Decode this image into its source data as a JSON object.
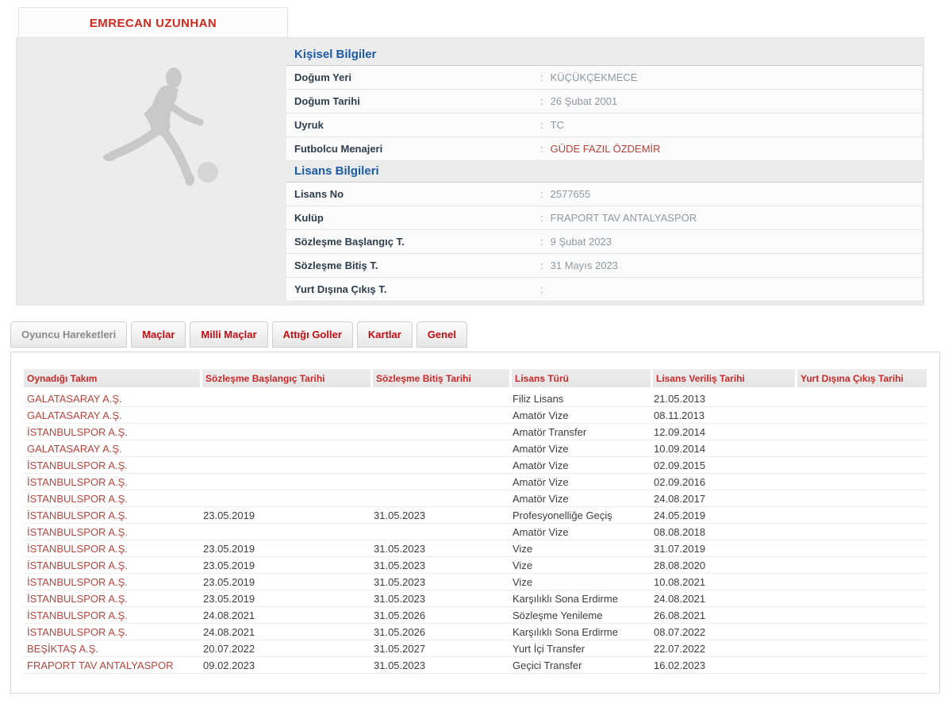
{
  "meta": {
    "colon": ":"
  },
  "player": {
    "name": "EMRECAN UZUNHAN"
  },
  "icons": {
    "photo_placeholder": "running-player-silhouette-icon"
  },
  "colors": {
    "title_red": "#D3281E",
    "tab_red": "#C40D12",
    "table_header_red": "#CD2727",
    "team_link_red": "#B8453F",
    "manager_link_red": "#B6423C",
    "heading_blue": "#1B5BA6",
    "label_dark": "#2F3E4C",
    "value_gray": "#8E99A3",
    "panel_gray": "#ECECEC"
  },
  "personal": {
    "title": "Kişisel Bilgiler",
    "rows": [
      {
        "label": "Doğum Yeri",
        "value": "KÜÇÜKÇEKMECE",
        "link": false
      },
      {
        "label": "Doğum Tarihi",
        "value": "26 Şubat 2001",
        "link": false
      },
      {
        "label": "Uyruk",
        "value": "TC",
        "link": false
      },
      {
        "label": "Futbolcu Menajeri",
        "value": "GÜDE FAZIL ÖZDEMİR",
        "link": true
      }
    ]
  },
  "license": {
    "title": "Lisans Bilgileri",
    "rows": [
      {
        "label": "Lisans No",
        "value": "2577655",
        "link": false
      },
      {
        "label": "Kulüp",
        "value": "FRAPORT TAV ANTALYASPOR",
        "link": false
      },
      {
        "label": "Sözleşme Başlangıç T.",
        "value": "9 Şubat 2023",
        "link": false
      },
      {
        "label": "Sözleşme Bitiş T.",
        "value": "31 Mayıs 2023",
        "link": false
      },
      {
        "label": "Yurt Dışına Çıkış T.",
        "value": "",
        "link": false
      }
    ]
  },
  "tabs": [
    {
      "label": "Oyuncu Hareketleri",
      "active": true
    },
    {
      "label": "Maçlar",
      "active": false
    },
    {
      "label": "Milli Maçlar",
      "active": false
    },
    {
      "label": "Attığı Goller",
      "active": false
    },
    {
      "label": "Kartlar",
      "active": false
    },
    {
      "label": "Genel",
      "active": false
    }
  ],
  "table": {
    "columns": [
      "Oynadığı Takım",
      "Sözleşme Başlangıç Tarihi",
      "Sözleşme Bitiş Tarihi",
      "Lisans Türü",
      "Lisans Veriliş Tarihi",
      "Yurt Dışına Çıkış Tarihi"
    ],
    "rows": [
      {
        "team": "GALATASARAY A.Ş.",
        "start": "",
        "end": "",
        "type": "Filiz Lisans",
        "issued": "21.05.2013",
        "abroad": ""
      },
      {
        "team": "GALATASARAY A.Ş.",
        "start": "",
        "end": "",
        "type": "Amatör Vize",
        "issued": "08.11.2013",
        "abroad": ""
      },
      {
        "team": "İSTANBULSPOR A.Ş.",
        "start": "",
        "end": "",
        "type": "Amatör Transfer",
        "issued": "12.09.2014",
        "abroad": ""
      },
      {
        "team": "GALATASARAY A.Ş.",
        "start": "",
        "end": "",
        "type": "Amatör Vize",
        "issued": "10.09.2014",
        "abroad": ""
      },
      {
        "team": "İSTANBULSPOR A.Ş.",
        "start": "",
        "end": "",
        "type": "Amatör Vize",
        "issued": "02.09.2015",
        "abroad": ""
      },
      {
        "team": "İSTANBULSPOR A.Ş.",
        "start": "",
        "end": "",
        "type": "Amatör Vize",
        "issued": "02.09.2016",
        "abroad": ""
      },
      {
        "team": "İSTANBULSPOR A.Ş.",
        "start": "",
        "end": "",
        "type": "Amatör Vize",
        "issued": "24.08.2017",
        "abroad": ""
      },
      {
        "team": "İSTANBULSPOR A.Ş.",
        "start": "23.05.2019",
        "end": "31.05.2023",
        "type": "Profesyonelliğe Geçiş",
        "issued": "24.05.2019",
        "abroad": ""
      },
      {
        "team": "İSTANBULSPOR A.Ş.",
        "start": "",
        "end": "",
        "type": "Amatör Vize",
        "issued": "08.08.2018",
        "abroad": ""
      },
      {
        "team": "İSTANBULSPOR A.Ş.",
        "start": "23.05.2019",
        "end": "31.05.2023",
        "type": "Vize",
        "issued": "31.07.2019",
        "abroad": ""
      },
      {
        "team": "İSTANBULSPOR A.Ş.",
        "start": "23.05.2019",
        "end": "31.05.2023",
        "type": "Vize",
        "issued": "28.08.2020",
        "abroad": ""
      },
      {
        "team": "İSTANBULSPOR A.Ş.",
        "start": "23.05.2019",
        "end": "31.05.2023",
        "type": "Vize",
        "issued": "10.08.2021",
        "abroad": ""
      },
      {
        "team": "İSTANBULSPOR A.Ş.",
        "start": "23.05.2019",
        "end": "31.05.2023",
        "type": "Karşılıklı Sona Erdirme",
        "issued": "24.08.2021",
        "abroad": ""
      },
      {
        "team": "İSTANBULSPOR A.Ş.",
        "start": "24.08.2021",
        "end": "31.05.2026",
        "type": "Sözleşme Yenileme",
        "issued": "26.08.2021",
        "abroad": ""
      },
      {
        "team": "İSTANBULSPOR A.Ş.",
        "start": "24.08.2021",
        "end": "31.05.2026",
        "type": "Karşılıklı Sona Erdirme",
        "issued": "08.07.2022",
        "abroad": ""
      },
      {
        "team": "BEŞİKTAŞ A.Ş.",
        "start": "20.07.2022",
        "end": "31.05.2027",
        "type": "Yurt İçi Transfer",
        "issued": "22.07.2022",
        "abroad": ""
      },
      {
        "team": "FRAPORT TAV ANTALYASPOR",
        "start": "09.02.2023",
        "end": "31.05.2023",
        "type": "Geçici Transfer",
        "issued": "16.02.2023",
        "abroad": ""
      }
    ]
  }
}
